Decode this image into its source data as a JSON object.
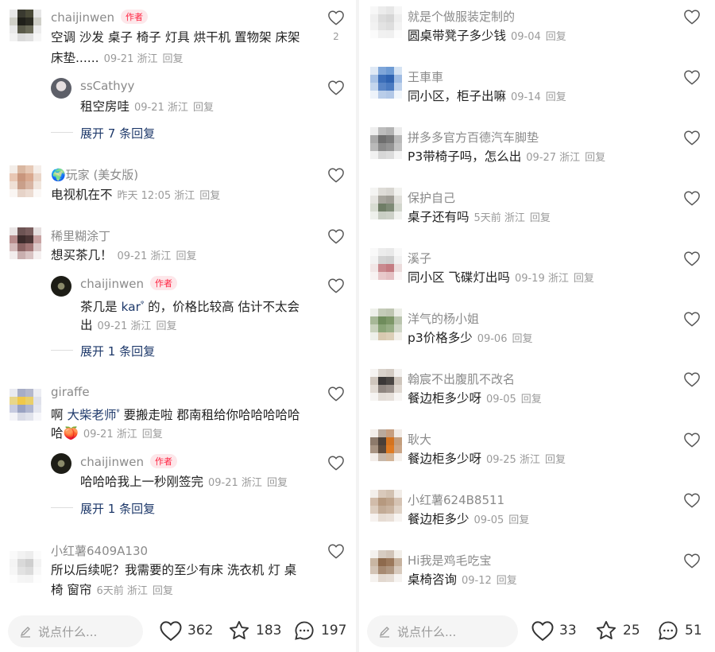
{
  "left": {
    "comments": [
      {
        "name": "chaijinwen",
        "badge": "作者",
        "text": "空调 沙发 桌子 椅子 灯具 烘干机 置物架 床架",
        "text2": "床垫......",
        "meta": "09-21 浙江",
        "reply": "回复",
        "like_count": "2",
        "avatar_colors": [
          "#e8e8e8",
          "#3a3a30",
          "#4a4a38",
          "#e6e6e6",
          "#d0d0c8",
          "#20201a",
          "#2b2b22",
          "#cfcfc8",
          "#e9e9e9",
          "#5a5a4a",
          "#6a6a58",
          "#ececec",
          "#f2f2f2",
          "#dadada",
          "#e0e0e0",
          "#f6f6f6"
        ]
      },
      {
        "name": "ssCathyy",
        "text": "租空房哇",
        "meta": "09-21 浙江",
        "reply": "回复",
        "expand": "展开 7 条回复"
      },
      {
        "name": "🌍玩家 (美女版)",
        "text": "电视机在不",
        "meta": "昨天 12:05 浙江",
        "reply": "回复",
        "avatar_colors": [
          "#f3ede8",
          "#d9b7a1",
          "#e6c9b6",
          "#f5eee9",
          "#e8c7b4",
          "#c9967d",
          "#d9a98f",
          "#ead6c9",
          "#efe0d6",
          "#c99f8a",
          "#d8b5a3",
          "#f1e6de",
          "#faf6f3",
          "#e6d3c8",
          "#ecdcd2",
          "#fbf8f6"
        ]
      },
      {
        "name": "稀里糊涂丁",
        "text": "想买茶几！",
        "meta": "09-21 浙江",
        "reply": "回复",
        "avatar_colors": [
          "#e9e4e4",
          "#6d5454",
          "#7a5e5e",
          "#e6e0e0",
          "#b78c8c",
          "#3c2b2b",
          "#4b3535",
          "#c8a2a2",
          "#d3b9b9",
          "#8a6262",
          "#a27676",
          "#dcc9c9",
          "#f2eded",
          "#c9aeae",
          "#d9c3c3",
          "#f5f0f0"
        ]
      },
      {
        "name": "chaijinwen",
        "badge": "作者",
        "text_a": "茶几是 ",
        "mention": "kar",
        "text_b": " 的，价格比较高 估计不太会",
        "text2": "出",
        "meta": "09-21 浙江",
        "reply": "回复",
        "expand": "展开 1 条回复"
      },
      {
        "name": "giraffe",
        "text_a": "啊 ",
        "mention": "大柴老师",
        "text_b": " 要搬走啦 郡南租给你哈哈哈哈哈",
        "text2": "哈🍑",
        "meta": "09-21 浙江",
        "reply": "回复",
        "avatar_colors": [
          "#e9eaf0",
          "#a7adc6",
          "#b4b8cc",
          "#ecedf3",
          "#e8d68a",
          "#f0c84a",
          "#e9cf6a",
          "#dfe1ea",
          "#c7cbe0",
          "#9aa2c2",
          "#b0b6cf",
          "#e4e6ef",
          "#f4f4f8",
          "#d9dbe6",
          "#e1e3ec",
          "#f6f6fa"
        ]
      },
      {
        "name": "chaijinwen",
        "badge": "作者",
        "text": "哈哈哈我上一秒刚签完",
        "meta": "09-21 浙江",
        "reply": "回复",
        "expand": "展开 1 条回复"
      },
      {
        "name": "小红薯6409A130",
        "text": "所以后续呢？我需要的至少有床 洗衣机 灯  桌",
        "text2": "椅  窗帘",
        "meta": "6天前 浙江",
        "reply": "回复",
        "avatar_colors": [
          "#fafafa",
          "#f2f2f2",
          "#ededed",
          "#fbfbfb",
          "#f4f4f4",
          "#d9d9d9",
          "#cfcfcf",
          "#f3f3f3",
          "#f6f6f6",
          "#e2e2e2",
          "#dbdbdb",
          "#f7f7f7",
          "#fcfcfc",
          "#f5f5f5",
          "#f4f4f4",
          "#fdfdfd"
        ]
      }
    ],
    "bottom": {
      "placeholder": "说点什么...",
      "likes": "362",
      "stars": "183",
      "comments": "197"
    }
  },
  "right": {
    "comments": [
      {
        "name": "就是个做服装定制的",
        "text": "圆桌带凳子多少钱",
        "meta": "09-04",
        "reply": "回复",
        "avatar_colors": [
          "#f7f7f7",
          "#ececec",
          "#e6e6e6",
          "#f6f6f6",
          "#efefef",
          "#dcdcdc",
          "#d6d6d6",
          "#eeeeee",
          "#f2f2f2",
          "#e3e3e3",
          "#dedede",
          "#f3f3f3",
          "#fbfbfb",
          "#f1f1f1",
          "#f0f0f0",
          "#fcfcfc"
        ]
      },
      {
        "name": "王車車",
        "text": "同小区，柜子出嘛",
        "meta": "09-14",
        "reply": "回复",
        "avatar_colors": [
          "#dfe9f5",
          "#7fa6d9",
          "#6e9bd4",
          "#d5e3f3",
          "#a9c3e6",
          "#3d6fb9",
          "#2f63b1",
          "#9fbce3",
          "#c4d6ee",
          "#5a86c7",
          "#4b7bc1",
          "#bfd2ec",
          "#eef3fa",
          "#b9cde9",
          "#b2c8e7",
          "#f1f6fb"
        ]
      },
      {
        "name": "拼多多官方百德汽车脚垫",
        "text": "P3带椅子吗，怎么出",
        "meta": "09-27 浙江",
        "reply": "回复",
        "avatar_colors": [
          "#eeeeee",
          "#bdbdbd",
          "#b3b3b3",
          "#ececec",
          "#a9a9a9",
          "#6e6e6e",
          "#7a7a7a",
          "#b8b8b8",
          "#b9b9b9",
          "#8b8b8b",
          "#959595",
          "#c3c3c3",
          "#f1f1f1",
          "#d7d7d7",
          "#dcdcdc",
          "#f4f4f4"
        ]
      },
      {
        "name": "保护自己",
        "text": "桌子还有吗",
        "meta": "5天前 浙江",
        "reply": "回复",
        "avatar_colors": [
          "#f4f4f2",
          "#dedcd7",
          "#d8d6d1",
          "#f2f2ef",
          "#e6e5e1",
          "#a7a59d",
          "#9e9c94",
          "#e0dfda",
          "#d8dcd2",
          "#6f7d66",
          "#7e8a76",
          "#d2d6cd",
          "#eef0ec",
          "#c9cec4",
          "#cdd1c8",
          "#f1f2ef"
        ]
      },
      {
        "name": "溪子",
        "text": "同小区 飞碟灯出吗",
        "meta": "09-19 浙江",
        "reply": "回复",
        "avatar_colors": [
          "#f9f9f9",
          "#ececec",
          "#e9e9e9",
          "#f8f8f8",
          "#f3f3f3",
          "#d3d3d3",
          "#cfcfcf",
          "#f1f1f1",
          "#f1e6e6",
          "#c98a8f",
          "#c47c82",
          "#ecdcdc",
          "#f8f2f2",
          "#e8c9cb",
          "#e4c0c3",
          "#faf5f5"
        ]
      },
      {
        "name": "洋气的杨小姐",
        "text": "p3价格多少",
        "meta": "09-06",
        "reply": "回复",
        "avatar_colors": [
          "#eef0ea",
          "#c4cbb8",
          "#bfc6b2",
          "#eceee7",
          "#a7b897",
          "#6f8c5c",
          "#7d9768",
          "#b9c4ad",
          "#c9d2bd",
          "#8aa477",
          "#98ae86",
          "#cfd6c6",
          "#eef0ea",
          "#d8c9b0",
          "#dccfb8",
          "#f2efe9"
        ]
      },
      {
        "name": "翰宸不出腹肌不改名",
        "text": "餐边柜多少呀",
        "meta": "09-05",
        "reply": "回复",
        "avatar_colors": [
          "#f5f3f1",
          "#d9d2cb",
          "#d3cbc3",
          "#f3f1ef",
          "#cfc6bd",
          "#3b3837",
          "#4a4643",
          "#cdc4bb",
          "#e2dbd4",
          "#8f8680",
          "#9a918b",
          "#e0d9d2",
          "#f6f4f2",
          "#e3ddd7",
          "#e6e0da",
          "#f7f5f3"
        ]
      },
      {
        "name": "耿大",
        "text": "餐边柜多少呀",
        "meta": "09-25 浙江",
        "reply": "回复",
        "avatar_colors": [
          "#f3eeea",
          "#b9a99c",
          "#c69e7f",
          "#f1ebe6",
          "#8d7a6b",
          "#4a3f38",
          "#d4731f",
          "#c39d7c",
          "#a89483",
          "#5c4a3c",
          "#e07b22",
          "#caa689",
          "#f2ede9",
          "#c6b7aa",
          "#d2b497",
          "#f5f0ec"
        ]
      },
      {
        "name": "小红薯624B8511",
        "text": "餐边柜多少",
        "meta": "09-05",
        "reply": "回复",
        "avatar_colors": [
          "#f3efeb",
          "#d9c9bb",
          "#d2c1b1",
          "#f1ece7",
          "#d1bcaa",
          "#b6997f",
          "#bea38b",
          "#d5c3b3",
          "#dccdbf",
          "#c2ab96",
          "#c9b39f",
          "#e0d3c7",
          "#f6f2ef",
          "#e6dcd3",
          "#e9e0d8",
          "#f7f4f1"
        ]
      },
      {
        "name": "Hi我是鸡毛吃宝",
        "text": "桌椅咨询",
        "meta": "09-12",
        "reply": "回复",
        "avatar_colors": [
          "#f4f1ee",
          "#d7ccc2",
          "#d1c4b8",
          "#f2eee9",
          "#c9b6a3",
          "#8e6a4d",
          "#9b785b",
          "#c6b19d",
          "#d3c4b6",
          "#a78a72",
          "#b09781",
          "#d8cabd",
          "#f5f2ef",
          "#e2d8cf",
          "#e5dcd4",
          "#f6f3f0"
        ]
      }
    ],
    "bottom": {
      "placeholder": "说点什么...",
      "likes": "33",
      "stars": "25",
      "comments": "51"
    }
  }
}
